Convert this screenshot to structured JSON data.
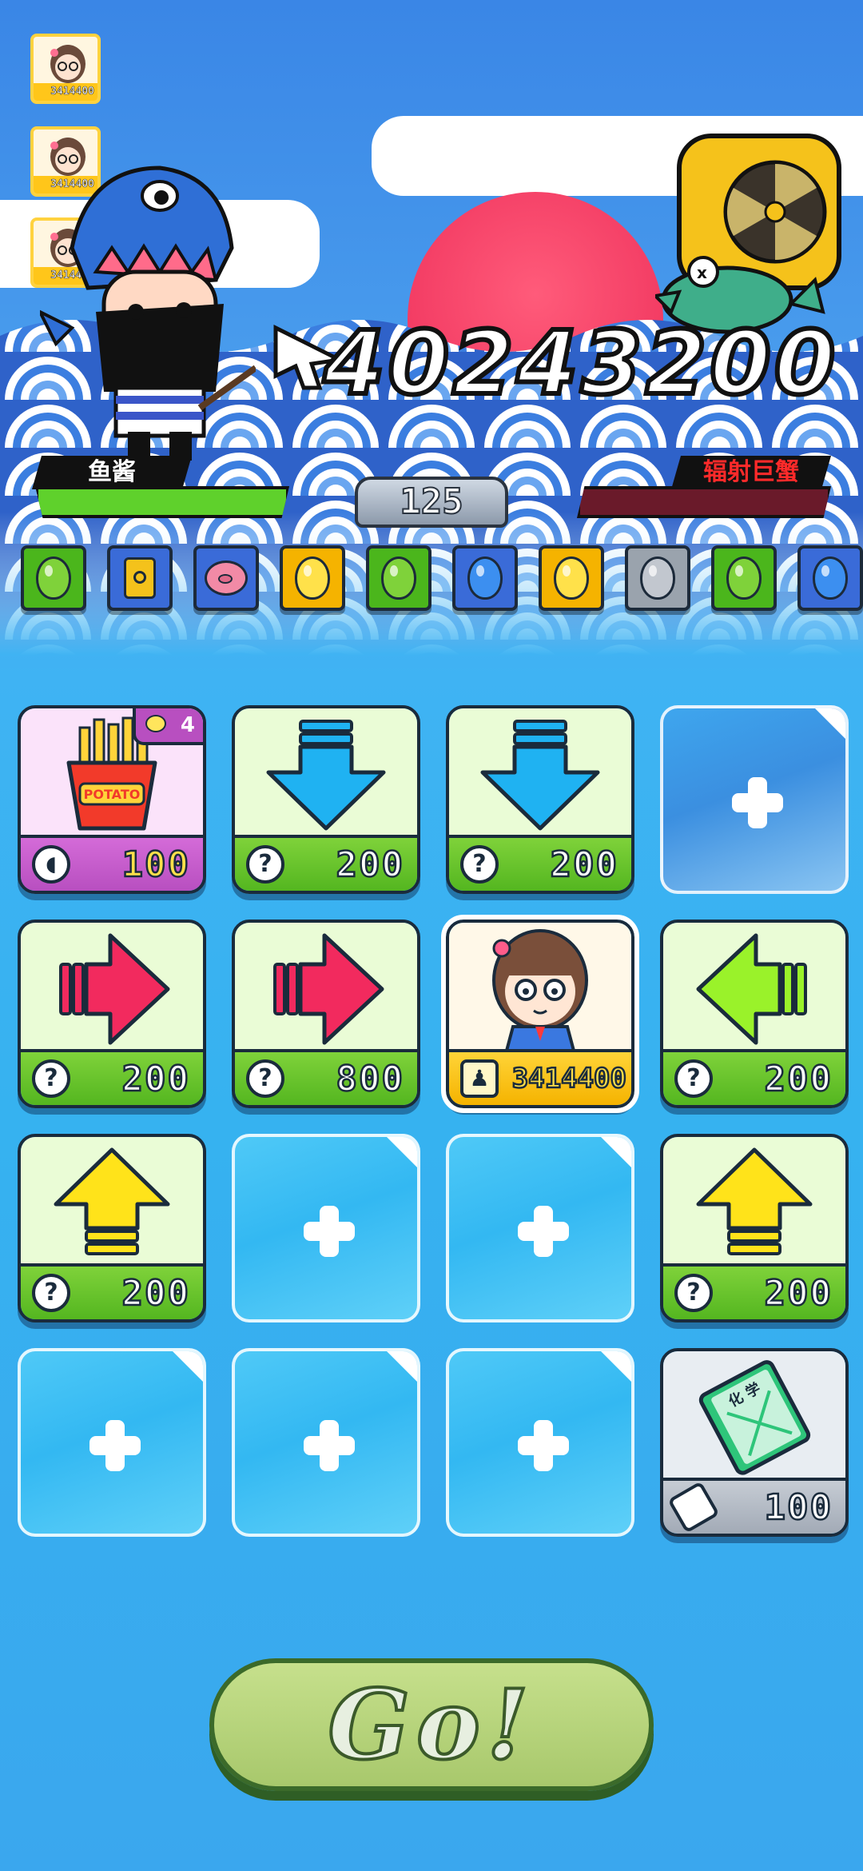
{
  "friends": [
    {
      "score": "3414400"
    },
    {
      "score": "3414400"
    },
    {
      "score": "3414400"
    }
  ],
  "battle": {
    "damage": "40243200",
    "player_name": "鱼酱",
    "enemy_name": "辐射巨蟹",
    "round": "125",
    "player_hp": 1.0,
    "enemy_hp": 0.0,
    "colors": {
      "player_hp": "#5fd12c",
      "enemy_hp": "#6a1a2a",
      "player_plate": "#111111",
      "enemy_name": "#ff2a2a"
    }
  },
  "queue": [
    {
      "icon": "green-balloon-icon",
      "color": "#7fd23a",
      "bg": "#4bb61c"
    },
    {
      "icon": "drum-icon",
      "color": "#f4c21b",
      "bg": "#3a6bd8"
    },
    {
      "icon": "pig-icon",
      "color": "#f28aa6",
      "bg": "#3a6bd8"
    },
    {
      "icon": "yellow-balloon-icon",
      "color": "#ffe14a",
      "bg": "#f5b300"
    },
    {
      "icon": "green-balloon-icon",
      "color": "#7fd23a",
      "bg": "#4bb61c"
    },
    {
      "icon": "blue-balloon-icon",
      "color": "#3c8ff0",
      "bg": "#3a6bd8"
    },
    {
      "icon": "yellow-balloon-icon",
      "color": "#ffe14a",
      "bg": "#f5b300"
    },
    {
      "icon": "gray-balloon-icon",
      "color": "#c2c7cf",
      "bg": "#9aa3ad"
    },
    {
      "icon": "green-balloon-icon",
      "color": "#7fd23a",
      "bg": "#4bb61c"
    },
    {
      "icon": "blue-balloon-icon",
      "color": "#3c8ff0",
      "bg": "#3a6bd8"
    }
  ],
  "cards": [
    {
      "kind": "fries",
      "cost": "100",
      "badge": "4",
      "foot": "purple",
      "face": "pink",
      "cost_icon": "bread-icon"
    },
    {
      "kind": "arrow-down-blue",
      "cost": "200",
      "foot": "green",
      "face": "lime",
      "cost_icon": "question-icon"
    },
    {
      "kind": "arrow-down-blue",
      "cost": "200",
      "foot": "green",
      "face": "lime",
      "cost_icon": "question-icon"
    },
    {
      "kind": "empty"
    },
    {
      "kind": "arrow-right-red",
      "cost": "200",
      "foot": "green",
      "face": "lime",
      "cost_icon": "question-icon"
    },
    {
      "kind": "arrow-right-red",
      "cost": "800",
      "foot": "green",
      "face": "lime",
      "cost_icon": "question-icon"
    },
    {
      "kind": "player",
      "cost": "3414400",
      "foot": "yellow",
      "face": "cream",
      "cost_icon": "user-icon"
    },
    {
      "kind": "arrow-left-green",
      "cost": "200",
      "foot": "green",
      "face": "lime",
      "cost_icon": "question-icon"
    },
    {
      "kind": "arrow-up-yellow",
      "cost": "200",
      "foot": "green",
      "face": "lime",
      "cost_icon": "question-icon"
    },
    {
      "kind": "empty"
    },
    {
      "kind": "empty"
    },
    {
      "kind": "arrow-up-yellow",
      "cost": "200",
      "foot": "green",
      "face": "lime",
      "cost_icon": "question-icon"
    },
    {
      "kind": "empty"
    },
    {
      "kind": "empty"
    },
    {
      "kind": "empty"
    },
    {
      "kind": "book",
      "cost": "100",
      "foot": "gray",
      "face": "light",
      "cost_icon": "eraser-icon"
    }
  ],
  "go_button": {
    "label": "Go!"
  }
}
